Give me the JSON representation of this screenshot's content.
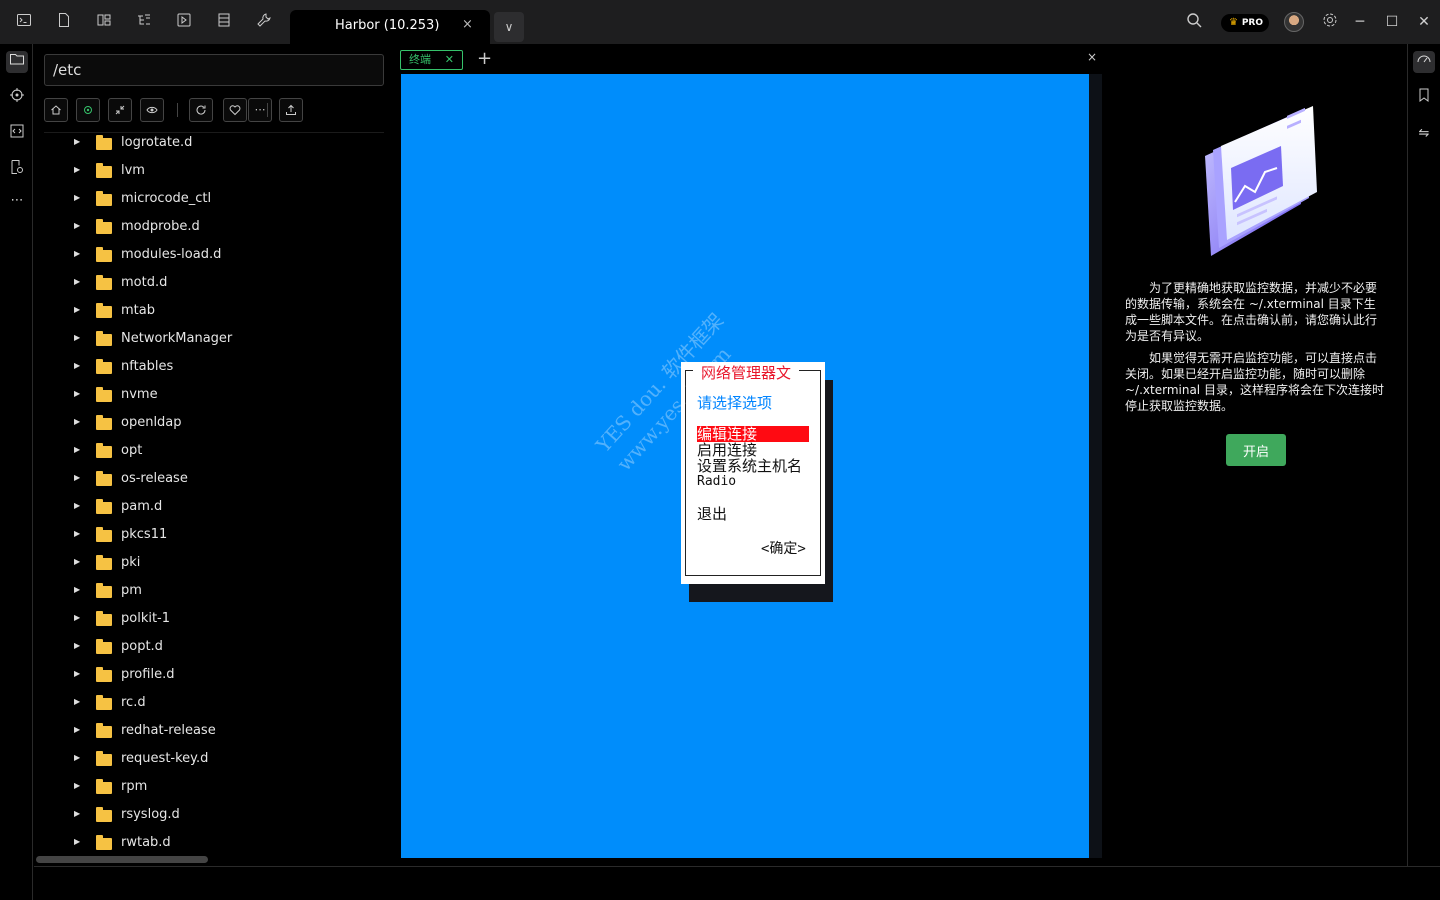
{
  "window": {
    "tab_title": "Harbor (10.253)",
    "tab_close": "×",
    "tab_dropdown": "∨",
    "pro_badge": "PRO",
    "controls": {
      "minimize": "─",
      "maximize": "☐",
      "close": "✕"
    }
  },
  "toolbar_icons": [
    "terminal-icon",
    "file-icon",
    "layout-icon",
    "tree-icon",
    "play-box-icon",
    "list-icon",
    "wrench-icon"
  ],
  "file_panel": {
    "path": "/etc",
    "items": [
      "logrotate.d",
      "lvm",
      "microcode_ctl",
      "modprobe.d",
      "modules-load.d",
      "motd.d",
      "mtab",
      "NetworkManager",
      "nftables",
      "nvme",
      "openldap",
      "opt",
      "os-release",
      "pam.d",
      "pkcs11",
      "pki",
      "pm",
      "polkit-1",
      "popt.d",
      "profile.d",
      "rc.d",
      "redhat-release",
      "request-key.d",
      "rpm",
      "rsyslog.d",
      "rwtab.d"
    ]
  },
  "terminal": {
    "tab_label": "终端",
    "tab_close": "✕",
    "add_tab": "+",
    "panel_close": "×",
    "dialog": {
      "title": "网络管理器文",
      "prompt": "请选择选项",
      "options": [
        "编辑连接",
        "启用连接",
        "设置系统主机名",
        "Radio",
        "退出"
      ],
      "selected_index": 0,
      "ok_button": "<确定>"
    },
    "watermark_line1": "YES   dou.   软件框架",
    "watermark_line2": "www.yes.     t.com"
  },
  "monitor_panel": {
    "paragraph1": "为了更精确地获取监控数据，并减少不必要的数据传输，系统会在 ~/.xterminal 目录下生成一些脚本文件。在点击确认前，请您确认此行为是否有异议。",
    "paragraph2": "如果觉得无需开启监控功能，可以直接点击关闭。如果已经开启监控功能，随时可以删除 ~/.xterminal 目录，这样程序将会在下次连接时停止获取监控数据。",
    "enable_button": "开启"
  },
  "colors": {
    "terminal_bg": "#008dfb",
    "dialog_selected": "#ff0a12",
    "dialog_title": "#e8142a",
    "accent_green": "#36c26b",
    "button_green": "#3fa85c"
  }
}
